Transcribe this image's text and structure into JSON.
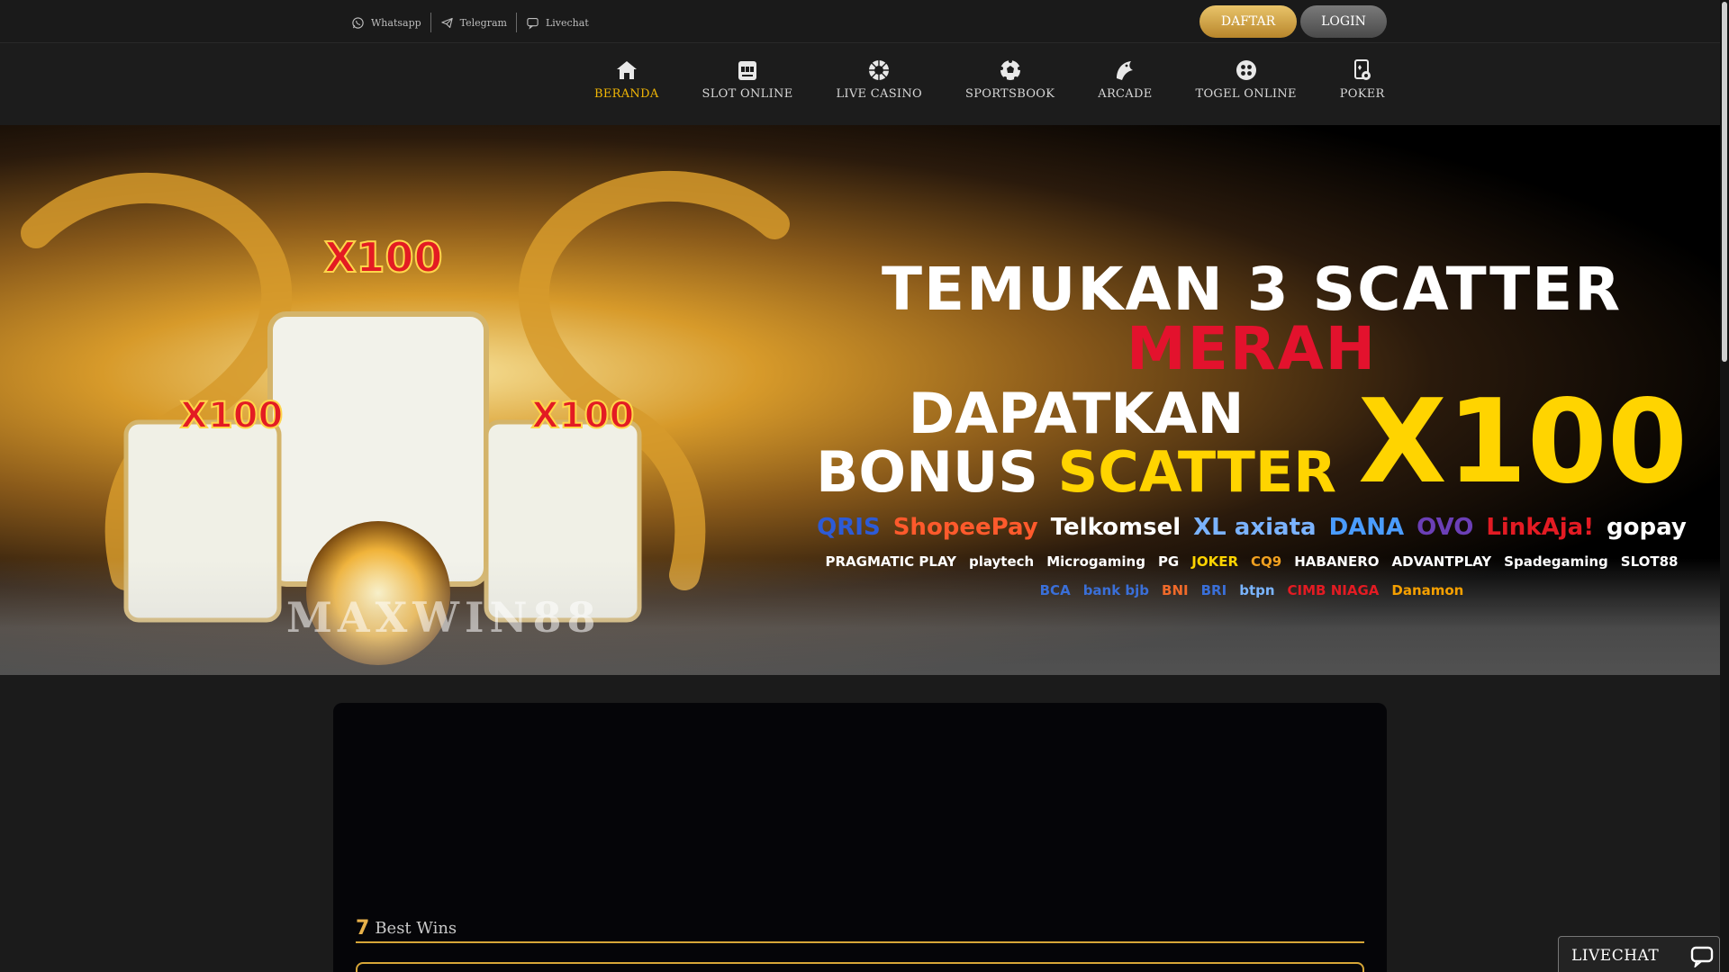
{
  "topbar": {
    "contacts": [
      {
        "label": "Whatsapp",
        "icon": "whatsapp-icon"
      },
      {
        "label": "Telegram",
        "icon": "telegram-icon"
      },
      {
        "label": "Livechat",
        "icon": "chat-icon"
      }
    ],
    "daftar_label": "DAFTAR",
    "login_label": "LOGIN"
  },
  "nav": {
    "items": [
      {
        "label": "BERANDA",
        "icon": "home-icon",
        "active": true
      },
      {
        "label": "SLOT ONLINE",
        "icon": "slot-machine-icon"
      },
      {
        "label": "LIVE CASINO",
        "icon": "roulette-icon"
      },
      {
        "label": "SPORTSBOOK",
        "icon": "soccer-ball-icon"
      },
      {
        "label": "ARCADE",
        "icon": "fish-icon"
      },
      {
        "label": "TOGEL ONLINE",
        "icon": "lottery-ball-icon"
      },
      {
        "label": "POKER",
        "icon": "cards-icon"
      }
    ],
    "active_color": "#f2b705"
  },
  "banner": {
    "line1_white": "TEMUKAN 3 SCATTER",
    "line1_red": "MERAH",
    "line2": "DAPATKAN",
    "line3_white": "BONUS",
    "line3_yellow": "SCATTER",
    "multiplier": "X100",
    "payment_logos": [
      "QRIS",
      "ShopeePay",
      "Telkomsel",
      "XL axiata",
      "DANA",
      "OVO",
      "LinkAja!",
      "gopay"
    ],
    "provider_logos": [
      "PRAGMATIC PLAY",
      "playtech",
      "Microgaming",
      "PG",
      "JOKER",
      "CQ9",
      "HABANERO",
      "ADVANTPLAY",
      "Spadegaming",
      "SLOT88"
    ],
    "bank_logos": [
      "BCA",
      "bank bjb",
      "BNI",
      "BRI",
      "btpn",
      "CIMB NIAGA",
      "Danamon"
    ],
    "tile_badges": [
      "X100",
      "X100",
      "X100"
    ],
    "brand_watermark": "MAXWIN88"
  },
  "content": {
    "best_wins_icon": "7",
    "best_wins_label": "Best Wins"
  },
  "livechat": {
    "label": "LIVECHAT",
    "icon": "chat-bubble-icon"
  },
  "colors": {
    "gold": "#d6a637",
    "background": "#1b1b1b",
    "panel": "#050508"
  }
}
